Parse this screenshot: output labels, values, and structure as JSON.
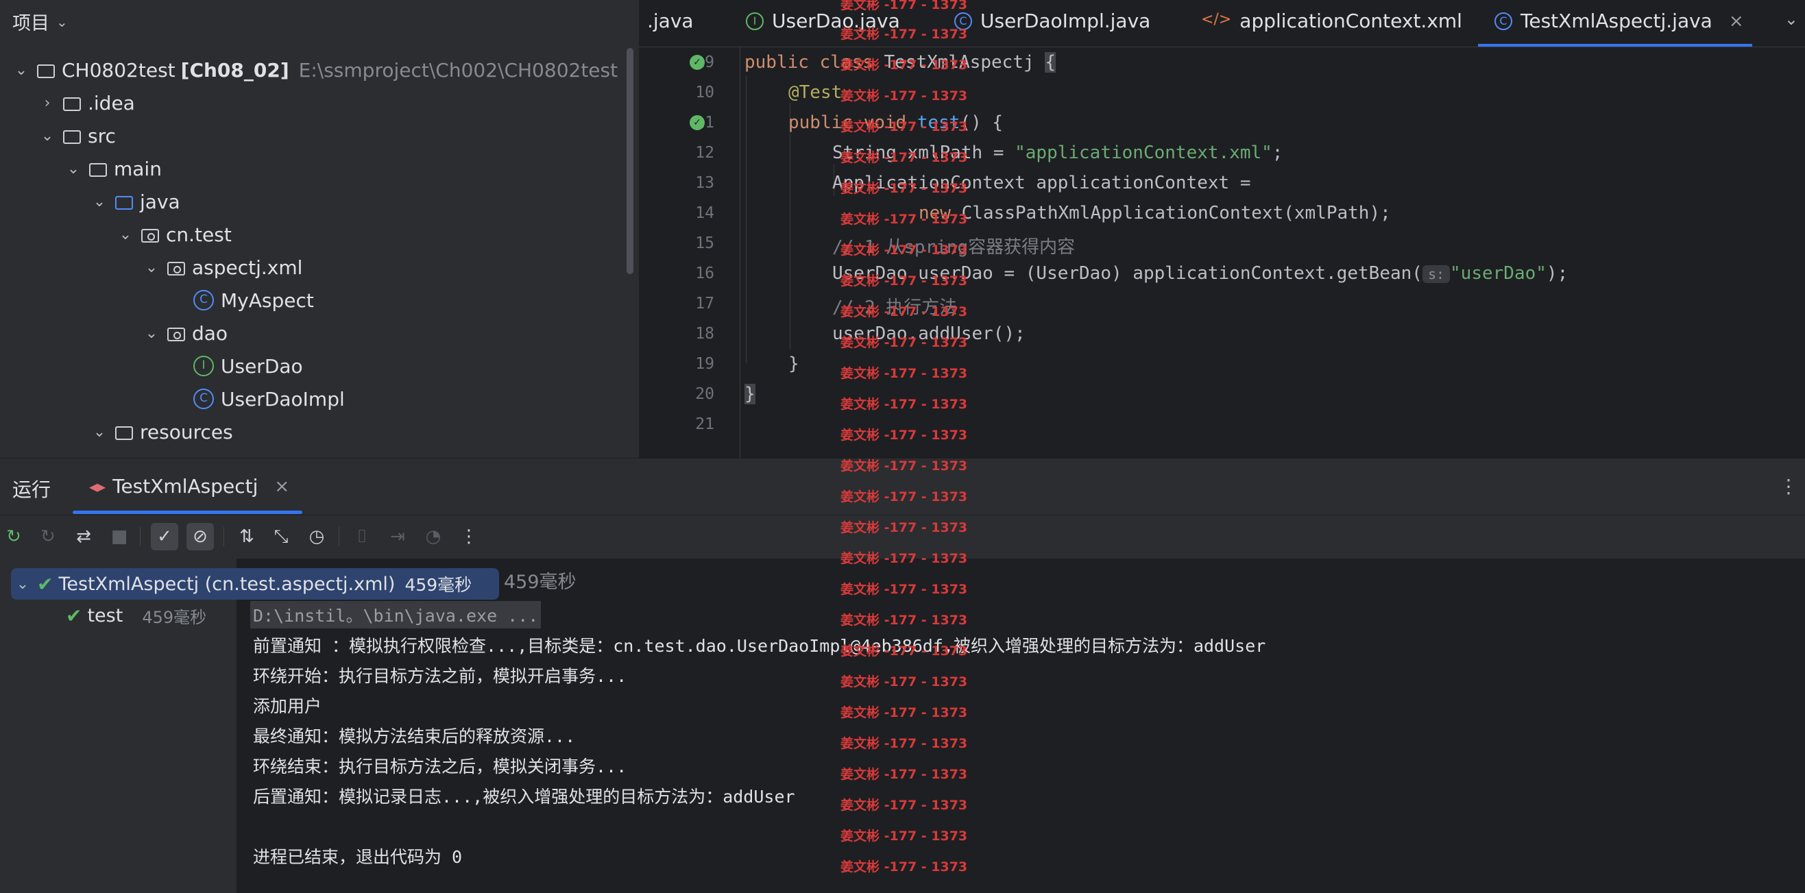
{
  "project": {
    "header": "项目",
    "tree": [
      {
        "label": "CH0802test",
        "bold": "[Ch08_02]",
        "path": "E:\\ssmproject\\Ch002\\CH0802test",
        "icon": "module-folder-icon",
        "arrow": "down"
      },
      {
        "label": ".idea",
        "icon": "folder-icon",
        "arrow": "right"
      },
      {
        "label": "src",
        "icon": "folder-icon",
        "arrow": "down"
      },
      {
        "label": "main",
        "icon": "folder-icon",
        "arrow": "down"
      },
      {
        "label": "java",
        "icon": "source-folder-icon",
        "arrow": "down"
      },
      {
        "label": "cn.test",
        "icon": "package-icon",
        "arrow": "down"
      },
      {
        "label": "aspectj.xml",
        "icon": "package-icon",
        "arrow": "down"
      },
      {
        "label": "MyAspect",
        "icon": "class-icon",
        "arrow": ""
      },
      {
        "label": "dao",
        "icon": "package-icon",
        "arrow": "down"
      },
      {
        "label": "UserDao",
        "icon": "interface-icon",
        "arrow": ""
      },
      {
        "label": "UserDaoImpl",
        "icon": "class-icon",
        "arrow": ""
      },
      {
        "label": "resources",
        "icon": "resources-folder-icon",
        "arrow": "down"
      }
    ]
  },
  "editor": {
    "tabs": [
      {
        "label": ".java",
        "icon": ""
      },
      {
        "label": "UserDao.java",
        "icon": "interface-icon"
      },
      {
        "label": "UserDaoImpl.java",
        "icon": "class-icon"
      },
      {
        "label": "applicationContext.xml",
        "icon": "xml-icon"
      },
      {
        "label": "TestXmlAspectj.java",
        "icon": "class-icon",
        "active": true
      }
    ],
    "line_numbers": [
      "9",
      "10",
      "11",
      "12",
      "13",
      "14",
      "15",
      "16",
      "17",
      "18",
      "19",
      "20",
      "21"
    ],
    "code": {
      "l9": {
        "kw": "public class ",
        "name": "TestXmlAspectj ",
        "brace": "{"
      },
      "l10": {
        "ann": "@Test"
      },
      "l11": {
        "kw": "public void ",
        "fn": "test",
        "rest": "() {"
      },
      "l12": {
        "a": "String xmlPath = ",
        "str": "\"applicationContext.xml\"",
        "b": ";"
      },
      "l13": {
        "a": "ApplicationContext applicationContext ="
      },
      "l14": {
        "kw": "new ",
        "a": "ClassPathXmlApplicationContext(xmlPath);"
      },
      "l15": {
        "cmt": "// 1 从spring容器获得内容"
      },
      "l16": {
        "a": "UserDao userDao = (UserDao) applicationContext.getBean(",
        "hint": "s:",
        "str": "\"userDao\"",
        "b": ");"
      },
      "l17": {
        "cmt": "// 2 执行方法"
      },
      "l18": {
        "a": "userDao.addUser();"
      },
      "l19": {
        "a": "}"
      },
      "l20": {
        "a": "}"
      }
    }
  },
  "run": {
    "title": "运行",
    "tab": "TestXmlAspectj",
    "test_root": {
      "label": "TestXmlAspectj (cn.test.aspectj.xml)",
      "duration": "459毫秒"
    },
    "test_child": {
      "label": "test",
      "duration": "459毫秒"
    },
    "console_duration": "459毫秒",
    "console": [
      "D:\\instil。\\bin\\java.exe ...",
      "前置通知 ：模拟执行权限检查...,目标类是：cn.test.dao.UserDaoImpl@4eb386df,被织入增强处理的目标方法为：addUser",
      "环绕开始：执行目标方法之前，模拟开启事务...",
      "添加用户",
      "最终通知：模拟方法结束后的释放资源...",
      "环绕结束：执行目标方法之后，模拟关闭事务...",
      "后置通知：模拟记录日志...,被织入增强处理的目标方法为：addUser",
      "",
      "进程已结束，退出代码为 0"
    ]
  },
  "watermark": "姜文彬 -177 - 1373"
}
